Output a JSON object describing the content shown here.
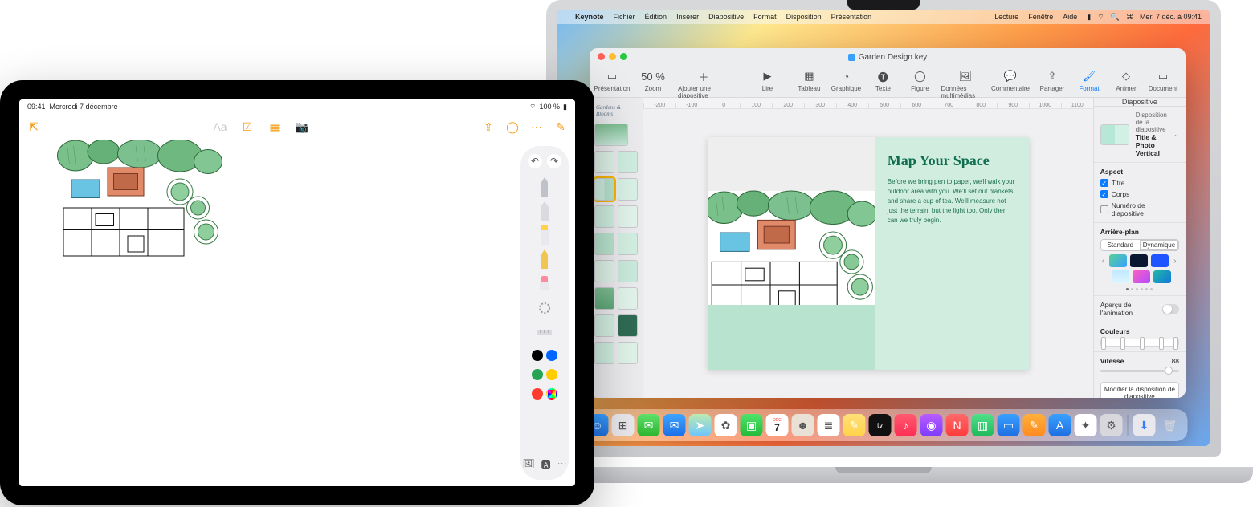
{
  "ipad": {
    "status": {
      "time": "09:41",
      "date": "Mercredi 7 décembre",
      "battery": "100 %"
    },
    "toolbar_left": {
      "collapse_icon": "collapse-fullscreen-icon"
    },
    "toolbar_center": {
      "text_style": "Aa",
      "checklist_icon": "checklist-icon",
      "table_icon": "table-icon",
      "camera_icon": "camera-icon"
    },
    "toolbar_right": {
      "share_icon": "share-icon",
      "markup_icon": "markup-pen-icon",
      "more_icon": "ellipsis-circle-icon",
      "compose_icon": "compose-icon"
    },
    "palette": {
      "undo": "undo-icon",
      "redo": "redo-icon",
      "tools": [
        "pen-tool",
        "marker-tool",
        "highlighter-tool",
        "pencil-tool",
        "eraser-tool",
        "lasso-tool",
        "ruler-tool"
      ],
      "colors": [
        "#000000",
        "#0066ff",
        "#26a454",
        "#ffcc00",
        "#ff3b30"
      ],
      "picker": "color-picker",
      "bottom": {
        "image": "insert-image-icon",
        "text": "insert-text-icon",
        "more": "more-icon"
      }
    }
  },
  "mac": {
    "menubar": {
      "apple": "",
      "app": "Keynote",
      "items": [
        "Fichier",
        "Édition",
        "Insérer",
        "Diapositive",
        "Format",
        "Disposition",
        "Présentation",
        "Lecture",
        "Fenêtre",
        "Aide"
      ],
      "clock": "Mer. 7 déc. à 09:41"
    },
    "window": {
      "title": "Garden Design.key",
      "toolbar": {
        "presentation": "Présentation",
        "zoom_value": "50 %",
        "zoom": "Zoom",
        "add_slide": "Ajouter une diapositive",
        "play": "Lire",
        "table": "Tableau",
        "chart": "Graphique",
        "text": "Texte",
        "shape": "Figure",
        "media": "Données multimédias",
        "comment": "Commentaire",
        "share": "Partager",
        "format": "Format",
        "animate": "Animer",
        "document": "Document"
      },
      "ruler_marks": [
        "-200",
        "-100",
        "0",
        "100",
        "200",
        "300",
        "400",
        "500",
        "600",
        "700",
        "800",
        "900",
        "1000",
        "1100"
      ],
      "nav_header": "Gardens & Blooms",
      "slide": {
        "heading": "Map Your Space",
        "body": "Before we bring pen to paper, we'll walk your outdoor area with you. We'll set out blankets and share a cup of tea. We'll measure not just the terrain, but the light too. Only then can we truly begin."
      },
      "inspector": {
        "tab": "Diapositive",
        "layout_label": "Disposition de la diapositive",
        "layout_name": "Title & Photo Vertical",
        "aspect_label": "Aspect",
        "cb_title": "Titre",
        "cb_body": "Corps",
        "cb_number": "Numéro de diapositive",
        "background_label": "Arrière-plan",
        "seg_standard": "Standard",
        "seg_dynamic": "Dynamique",
        "swatches": [
          "linear-gradient(135deg,#56d196,#39a0ff)",
          "#0b1630",
          "#1f55ff",
          "linear-gradient(#bfe9ff,#dff6ff)",
          "linear-gradient(135deg,#ff5fbf,#b04dff)",
          "linear-gradient(135deg,#1fb8a6,#1277d9)"
        ],
        "anim_preview": "Aperçu de l'animation",
        "colors_label": "Couleurs",
        "speed_label": "Vitesse",
        "speed_value": "88",
        "edit_button": "Modifier la disposition de diapositive"
      }
    },
    "dock": {
      "calendar_label": "DÉC",
      "calendar_day": "7",
      "apps": [
        {
          "name": "finder",
          "bg": "linear-gradient(#39a0ff,#1f6fe0)",
          "glyph": "☺"
        },
        {
          "name": "launchpad",
          "bg": "#e8e8ec",
          "glyph": "⊞"
        },
        {
          "name": "messages",
          "bg": "linear-gradient(#5fe06a,#2bb52f)",
          "glyph": "✉"
        },
        {
          "name": "mail",
          "bg": "linear-gradient(#3fa4ff,#1b6fe8)",
          "glyph": "✉"
        },
        {
          "name": "maps",
          "bg": "linear-gradient(#bde9b1,#6bc6ff)",
          "glyph": "➤"
        },
        {
          "name": "photos",
          "bg": "#fff",
          "glyph": "✿"
        },
        {
          "name": "facetime",
          "bg": "linear-gradient(#4fe46a,#23b93a)",
          "glyph": "▣"
        },
        {
          "name": "calendar",
          "bg": "#fff",
          "glyph": ""
        },
        {
          "name": "contacts",
          "bg": "#e9e1d6",
          "glyph": "☻"
        },
        {
          "name": "reminders",
          "bg": "#fff",
          "glyph": "≣"
        },
        {
          "name": "notes",
          "bg": "linear-gradient(#ffe178,#ffd24a)",
          "glyph": "✎"
        },
        {
          "name": "tv",
          "bg": "#111",
          "glyph": "tv"
        },
        {
          "name": "music",
          "bg": "linear-gradient(#ff5a6e,#ff2d55)",
          "glyph": "♪"
        },
        {
          "name": "podcasts",
          "bg": "linear-gradient(#b95cff,#7d3cff)",
          "glyph": "◉"
        },
        {
          "name": "news",
          "bg": "linear-gradient(#ff6a6a,#ff3b3b)",
          "glyph": "N"
        },
        {
          "name": "numbers",
          "bg": "linear-gradient(#4fe08a,#1fb85a)",
          "glyph": "▥"
        },
        {
          "name": "keynote",
          "bg": "linear-gradient(#39a0ff,#1f6fe0)",
          "glyph": "▭"
        },
        {
          "name": "pages",
          "bg": "linear-gradient(#ffb03a,#ff8a1f)",
          "glyph": "✎"
        },
        {
          "name": "appstore",
          "bg": "linear-gradient(#39a0ff,#1f6fe0)",
          "glyph": "A"
        },
        {
          "name": "safari",
          "bg": "#fff",
          "glyph": "✦"
        },
        {
          "name": "settings",
          "bg": "#d8d8dc",
          "glyph": "⚙"
        }
      ],
      "right": [
        {
          "name": "downloads",
          "bg": "#e9e9ed",
          "glyph": "⬇"
        },
        {
          "name": "trash",
          "bg": "transparent",
          "glyph": "🗑"
        }
      ]
    }
  }
}
